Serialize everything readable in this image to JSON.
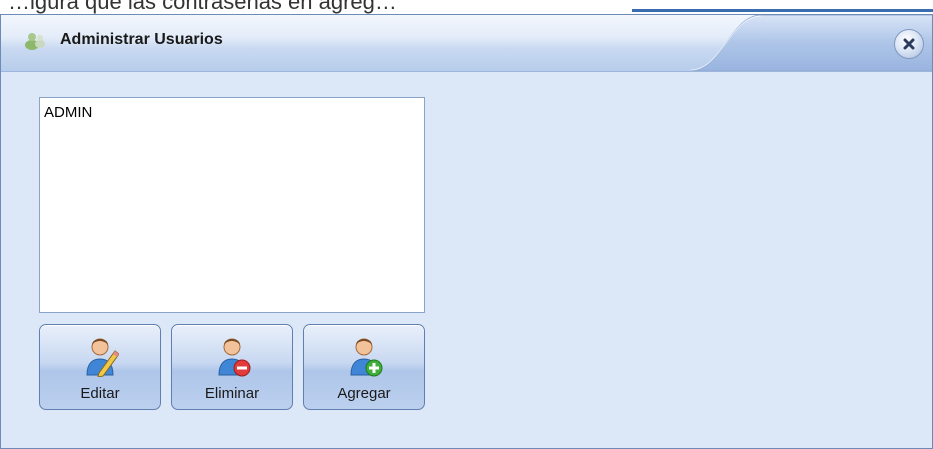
{
  "background": {
    "partial_text": "…igura que las contraseñas en agreg…"
  },
  "window": {
    "title": "Administrar Usuarios",
    "close_icon": "close-icon"
  },
  "user_list": {
    "items": [
      "ADMIN"
    ]
  },
  "buttons": {
    "edit_label": "Editar",
    "delete_label": "Eliminar",
    "add_label": "Agregar"
  },
  "colors": {
    "window_bg": "#dce7f8",
    "titlebar_bg": "#c9d9f1",
    "button_border": "#5f7fb0"
  }
}
